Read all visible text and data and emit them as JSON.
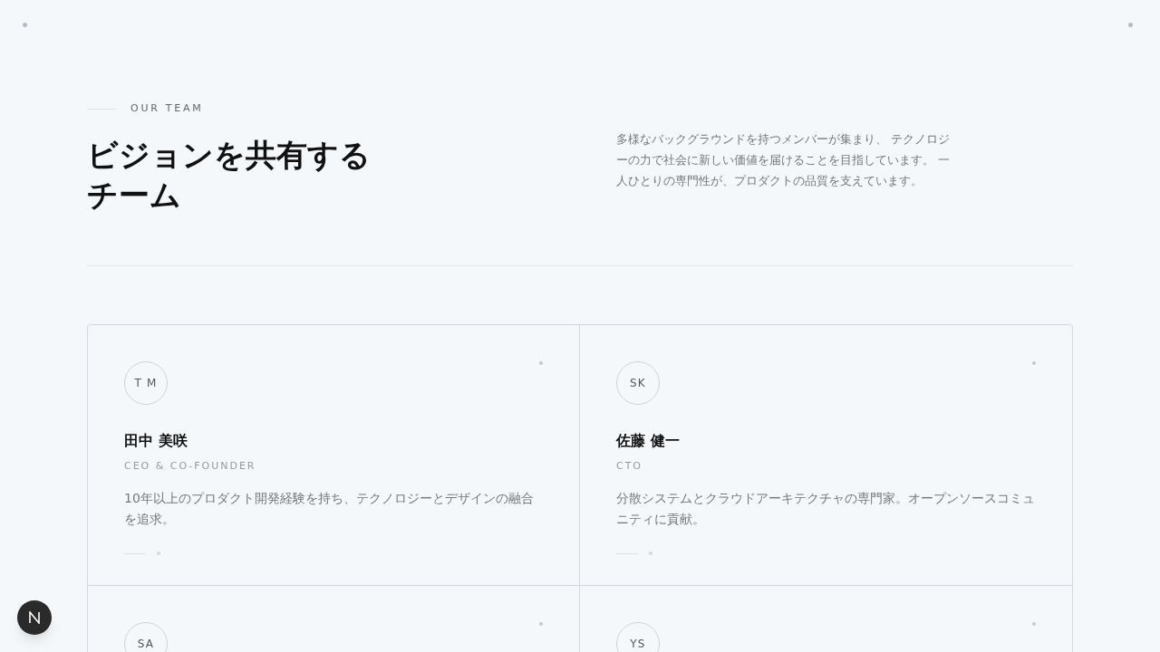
{
  "section": {
    "eyebrow": "OUR TEAM",
    "heading_lines": [
      "ビジョンを共有する",
      "チーム"
    ],
    "intro": "多様なバックグラウンドを持つメンバーが集まり、 テクノロジーの力で社会に新しい価値を届けることを目指しています。 一人ひとりの専門性が、プロダクトの品質を支えています。"
  },
  "members": [
    {
      "initials": "T M",
      "name": "田中 美咲",
      "role": "CEO & CO-FOUNDER",
      "bio": "10年以上のプロダクト開発経験を持ち、テクノロジーとデザインの融合を追求。"
    },
    {
      "initials": "SK",
      "name": "佐藤 健一",
      "role": "CTO",
      "bio": "分散システムとクラウドアーキテクチャの専門家。オープンソースコミュニティに貢献。"
    },
    {
      "initials": "SA"
    },
    {
      "initials": "YS"
    }
  ]
}
